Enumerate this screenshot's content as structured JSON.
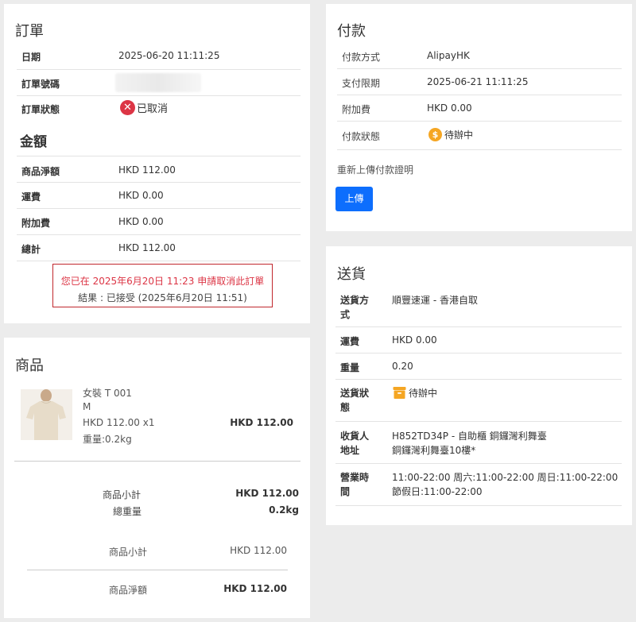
{
  "order": {
    "title": "訂單",
    "rows": [
      {
        "label": "日期",
        "value": "2025-06-20 11:11:25"
      },
      {
        "label": "訂單號碼",
        "value": ""
      },
      {
        "label": "訂單狀態",
        "value": "已取消"
      }
    ]
  },
  "amount": {
    "title": "金額",
    "rows": [
      {
        "label": "商品淨額",
        "value": "HKD 112.00"
      },
      {
        "label": "運費",
        "value": "HKD 0.00"
      },
      {
        "label": "附加費",
        "value": "HKD 0.00"
      },
      {
        "label": "總計",
        "value": "HKD 112.00"
      }
    ],
    "cancel_notice": "您已在 2025年6月20日 11:23 申請取消此訂單",
    "cancel_result": "結果 : 已接受 (2025年6月20日 11:51)"
  },
  "products": {
    "title": "商品",
    "item": {
      "name": "女裝 T 001",
      "size": "M",
      "price_qty": "HKD 112.00 x1",
      "weight": "重量:0.2kg",
      "line_total": "HKD 112.00"
    },
    "summary": [
      {
        "label": "商品小計",
        "value": "HKD 112.00"
      },
      {
        "label": "總重量",
        "value": "0.2kg"
      }
    ],
    "totals": [
      {
        "label": "商品小計",
        "value": "HKD 112.00"
      },
      {
        "label": "商品淨額",
        "value": "HKD 112.00"
      }
    ]
  },
  "payment": {
    "title": "付款",
    "rows": [
      {
        "label": "付款方式",
        "value": "AlipayHK"
      },
      {
        "label": "支付限期",
        "value": "2025-06-21 11:11:25"
      },
      {
        "label": "附加費",
        "value": "HKD 0.00"
      },
      {
        "label": "付款狀態",
        "value": "待辦中"
      }
    ],
    "reupload_text": "重新上傳付款證明",
    "upload_button": "上傳"
  },
  "delivery": {
    "title": "送貨",
    "rows": [
      {
        "label": "送貨方式",
        "value": "順豐速運 - 香港自取"
      },
      {
        "label": "運費",
        "value": "HKD 0.00"
      },
      {
        "label": "重量",
        "value": "0.20"
      },
      {
        "label": "送貨狀態",
        "value": "待辦中"
      },
      {
        "label": "收貨人地址",
        "value_line1": "H852TD34P - 自助櫃 銅鑼灣利舞臺",
        "value_line2": "銅鑼灣利舞臺10樓*"
      },
      {
        "label": "營業時間",
        "value": "11:00-22:00 周六:11:00-22:00 周日:11:00-22:00 節假日:11:00-22:00"
      }
    ]
  },
  "colors": {
    "accent": "#0d6efd",
    "danger": "#dc3545",
    "warning": "#f5a623"
  }
}
